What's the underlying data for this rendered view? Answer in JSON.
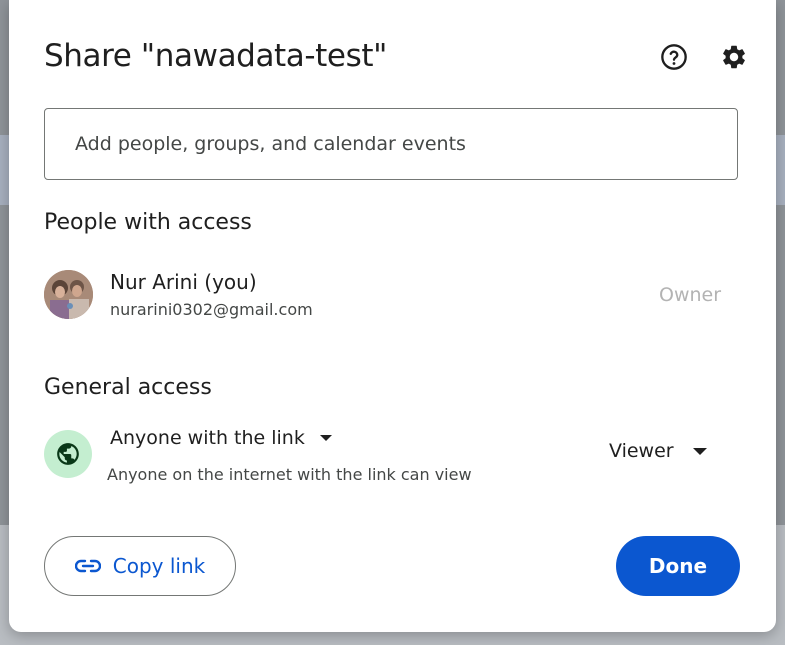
{
  "dialog": {
    "title": "Share \"nawadata-test\"",
    "help_icon": "help-circle-icon",
    "settings_icon": "gear-icon"
  },
  "add_people": {
    "placeholder": "Add people, groups, and calendar events"
  },
  "people_with_access": {
    "heading": "People with access",
    "people": [
      {
        "name": "Nur Arini (you)",
        "email": "nurarini0302@gmail.com",
        "role": "Owner"
      }
    ]
  },
  "general_access": {
    "heading": "General access",
    "icon": "globe-icon",
    "selected": "Anyone with the link",
    "description": "Anyone on the internet with the link can view",
    "role": "Viewer"
  },
  "actions": {
    "copy_link_label": "Copy link",
    "copy_link_icon": "link-icon",
    "done_label": "Done"
  },
  "colors": {
    "primary": "#0b57d0",
    "globe_bg": "#c4eed0",
    "owner_text": "#b3b3b3"
  }
}
